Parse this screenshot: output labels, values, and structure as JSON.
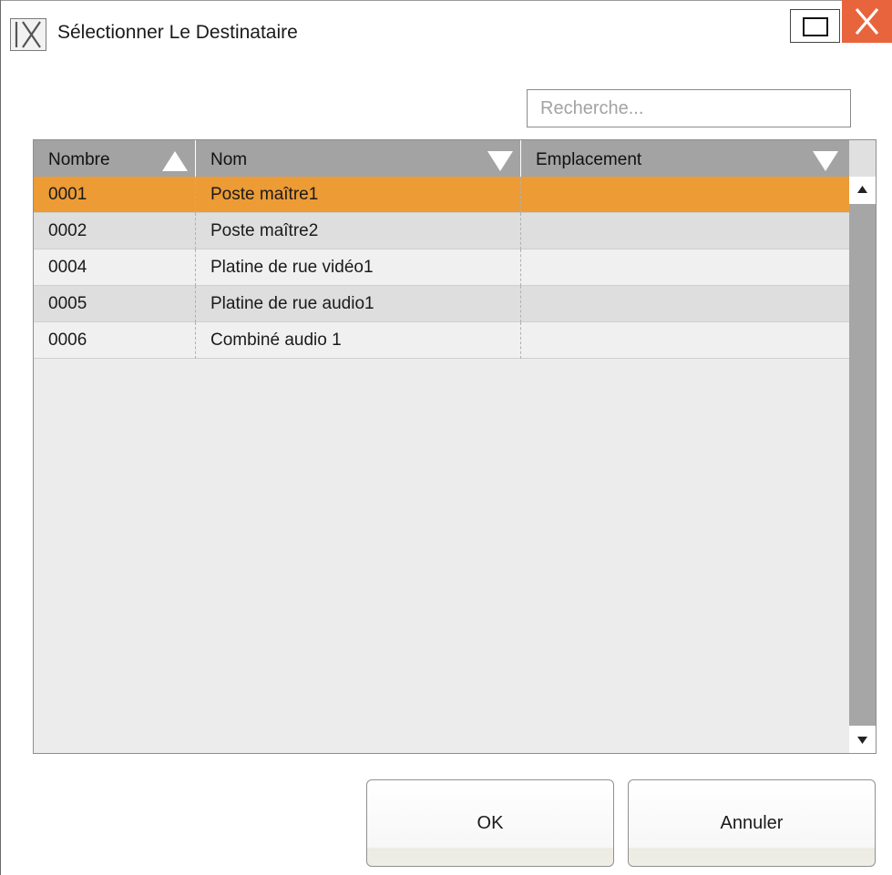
{
  "window": {
    "title": "Sélectionner Le Destinataire",
    "icon": "ix-app-icon",
    "controls": [
      "maximize-icon",
      "close-icon"
    ],
    "close_color": "#e8643c"
  },
  "search": {
    "placeholder": "Recherche...",
    "value": ""
  },
  "table": {
    "columns": [
      {
        "label": "Nombre",
        "sort": "ascending"
      },
      {
        "label": "Nom",
        "sort": "descending"
      },
      {
        "label": "Emplacement",
        "sort": "descending"
      }
    ],
    "rows": [
      {
        "number": "0001",
        "name": "Poste maître1",
        "location": "",
        "selected": true
      },
      {
        "number": "0002",
        "name": "Poste maître2",
        "location": "",
        "selected": false
      },
      {
        "number": "0004",
        "name": "Platine de rue vidéo1",
        "location": "",
        "selected": false
      },
      {
        "number": "0005",
        "name": "Platine de rue audio1",
        "location": "",
        "selected": false
      },
      {
        "number": "0006",
        "name": "Combiné audio 1",
        "location": "",
        "selected": false
      }
    ],
    "selected_color": "#ec9b35"
  },
  "buttons": {
    "ok": "OK",
    "cancel": "Annuler"
  }
}
